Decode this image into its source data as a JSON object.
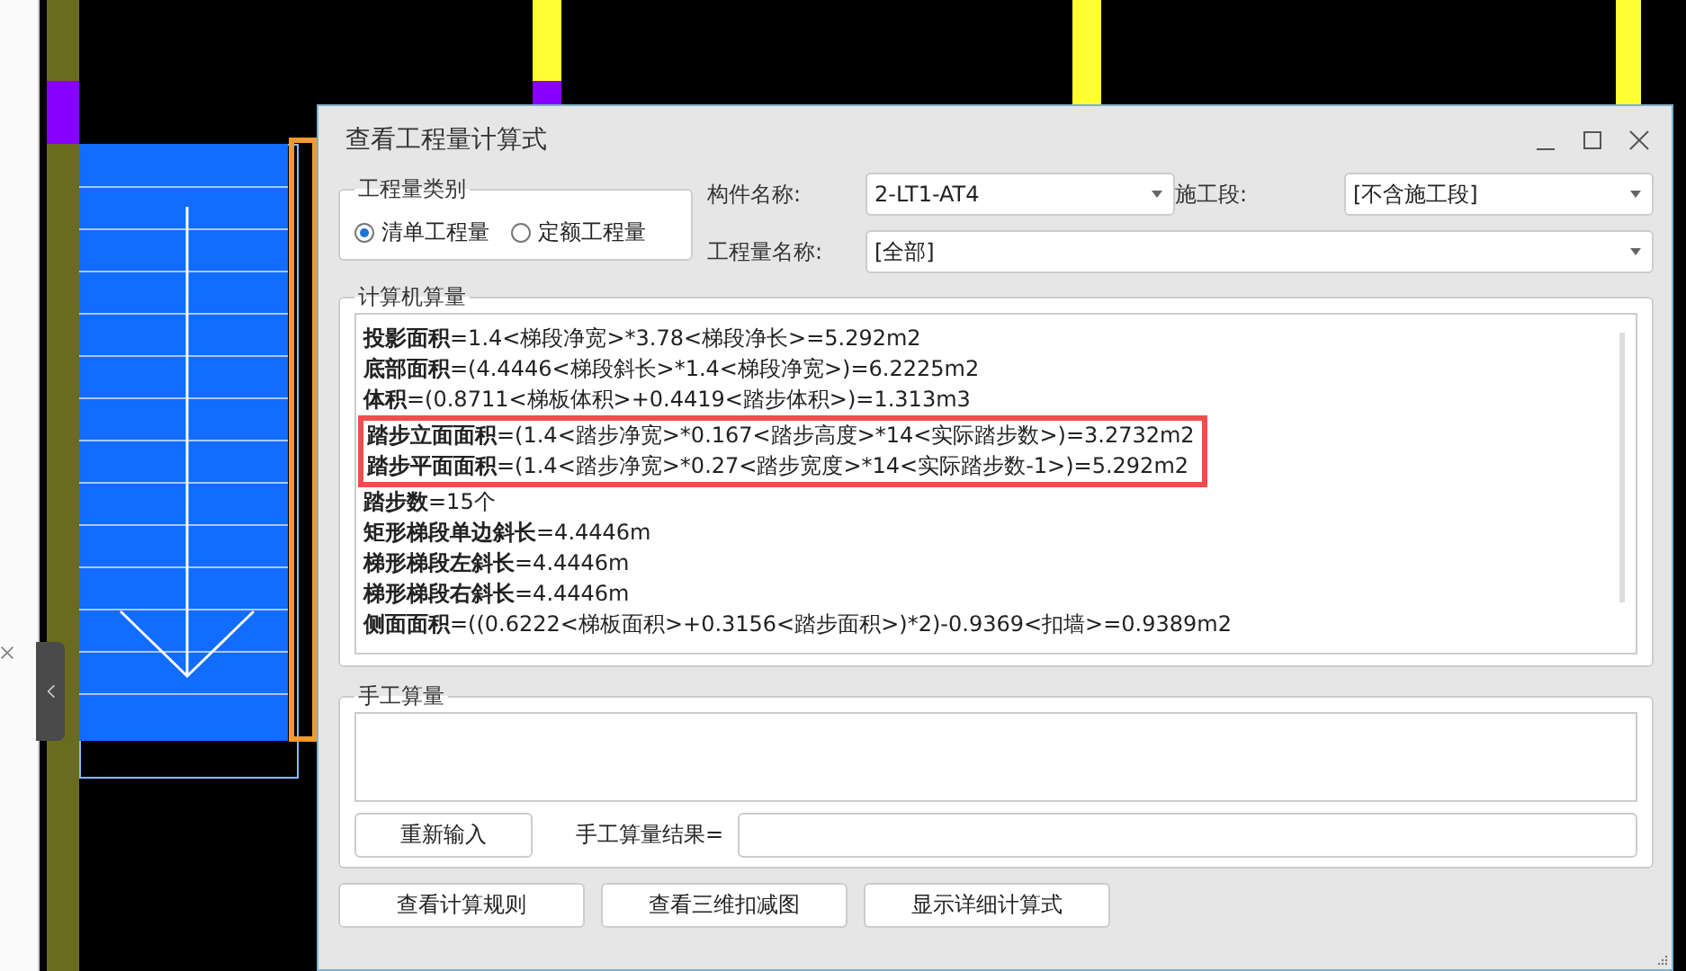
{
  "window": {
    "title": "查看工程量计算式"
  },
  "quantity_type": {
    "legend": "工程量类别",
    "options": [
      {
        "label": "清单工程量",
        "selected": true
      },
      {
        "label": "定额工程量",
        "selected": false
      }
    ]
  },
  "fields": [
    {
      "label": "构件名称:",
      "value": "2-LT1-AT4"
    },
    {
      "label": "施工段:",
      "value": "[不含施工段]"
    },
    {
      "label": "工程量名称:",
      "value": "[全部]"
    }
  ],
  "computed": {
    "legend": "计算机算量",
    "lines": [
      {
        "text": "**投影面积**=1.4<梯段净宽>*3.78<梯段净长>=5.292m2",
        "highlighted": false
      },
      {
        "text": "**底部面积**=(4.4446<梯段斜长>*1.4<梯段净宽>)=6.2225m2",
        "highlighted": false
      },
      {
        "text": "**体积**=(0.8711<梯板体积>+0.4419<踏步体积>)=1.313m3",
        "highlighted": false
      },
      {
        "text": "**踏步立面面积**=(1.4<踏步净宽>*0.167<踏步高度>*14<实际踏步数>)=3.2732m2",
        "highlighted": true
      },
      {
        "text": "**踏步平面面积**=(1.4<踏步净宽>*0.27<踏步宽度>*14<实际踏步数-1>)=5.292m2",
        "highlighted": true
      },
      {
        "text": "**踏步数**=15个",
        "highlighted": false
      },
      {
        "text": "**矩形梯段单边斜长**=4.4446m",
        "highlighted": false
      },
      {
        "text": "**梯形梯段左斜长**=4.4446m",
        "highlighted": false
      },
      {
        "text": "**梯形梯段右斜长**=4.4446m",
        "highlighted": false
      },
      {
        "text": "**侧面面积**=((0.6222<梯板面积>+0.3156<踏步面积>)*2)-0.9369<扣墙>=0.9389m2",
        "highlighted": false
      }
    ]
  },
  "manual": {
    "legend": "手工算量",
    "reset_button": "重新输入",
    "result_label": "手工算量结果="
  },
  "buttons": [
    "查看计算规则",
    "查看三维扣减图",
    "显示详细计算式"
  ]
}
